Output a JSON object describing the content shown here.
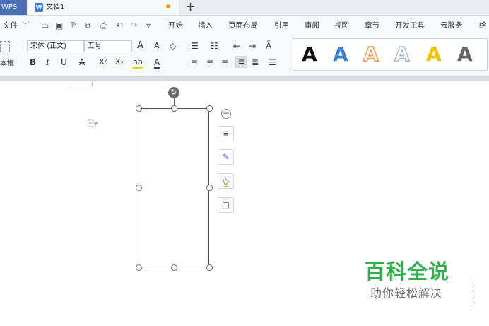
{
  "tabs": {
    "app_label": "WPS",
    "document": {
      "name": "文档1",
      "icon_letter": "W",
      "modified_dot_color": "#f0a020"
    },
    "new_tab": "+"
  },
  "menu": {
    "file": "文件",
    "items": [
      "开始",
      "插入",
      "页面布局",
      "引用",
      "审阅",
      "视图",
      "章节",
      "开发工具",
      "云服务",
      "绘"
    ]
  },
  "ribbon": {
    "textbox_partial": "本框",
    "font_name": "宋体 (正文)",
    "font_size": "五号",
    "grow_font": "A",
    "shrink_font": "A",
    "bold": "B",
    "italic": "I",
    "underline": "U",
    "strike": "A",
    "superscript": "X²",
    "subscript": "X₂",
    "highlight": "ab",
    "font_color": "A",
    "style_samples": [
      {
        "glyph": "A",
        "color": "#111111"
      },
      {
        "glyph": "A",
        "color": "#3b82d6"
      },
      {
        "glyph": "A",
        "color": "#f29a4a"
      },
      {
        "glyph": "A",
        "color": "#9db3d6"
      },
      {
        "glyph": "A",
        "color": "#f5c000"
      },
      {
        "glyph": "A",
        "color": "#666666"
      }
    ]
  },
  "canvas": {
    "rotate_icon": "↻",
    "collapse_icon": "−",
    "float_tools": [
      "layout-options",
      "outline-pen",
      "fill-bucket",
      "border-frame"
    ]
  },
  "watermark": {
    "title": "百科全说",
    "subtitle": "助你轻松解决",
    "title_color": "#2fb24c"
  }
}
